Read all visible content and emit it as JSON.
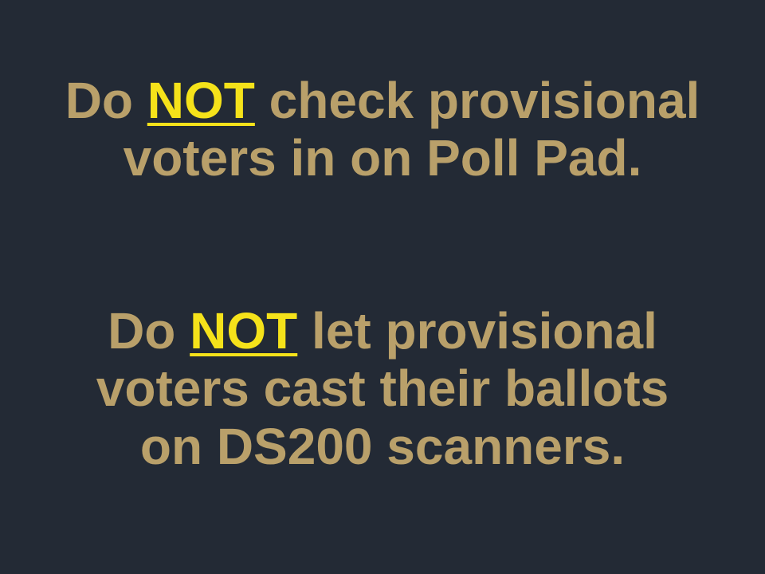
{
  "slide": {
    "paragraphs": [
      {
        "line1_prefix": "Do ",
        "emphasis": "NOT",
        "line1_suffix": " check provisional",
        "line2": "voters in on Poll Pad."
      },
      {
        "line1_prefix": "Do ",
        "emphasis": "NOT",
        "line1_suffix": " let provisional",
        "line2": "voters cast their ballots",
        "line3": "on DS200 scanners."
      }
    ]
  },
  "colors": {
    "background": "#232a35",
    "text": "#b9a06a",
    "emphasis": "#f5e21a"
  }
}
